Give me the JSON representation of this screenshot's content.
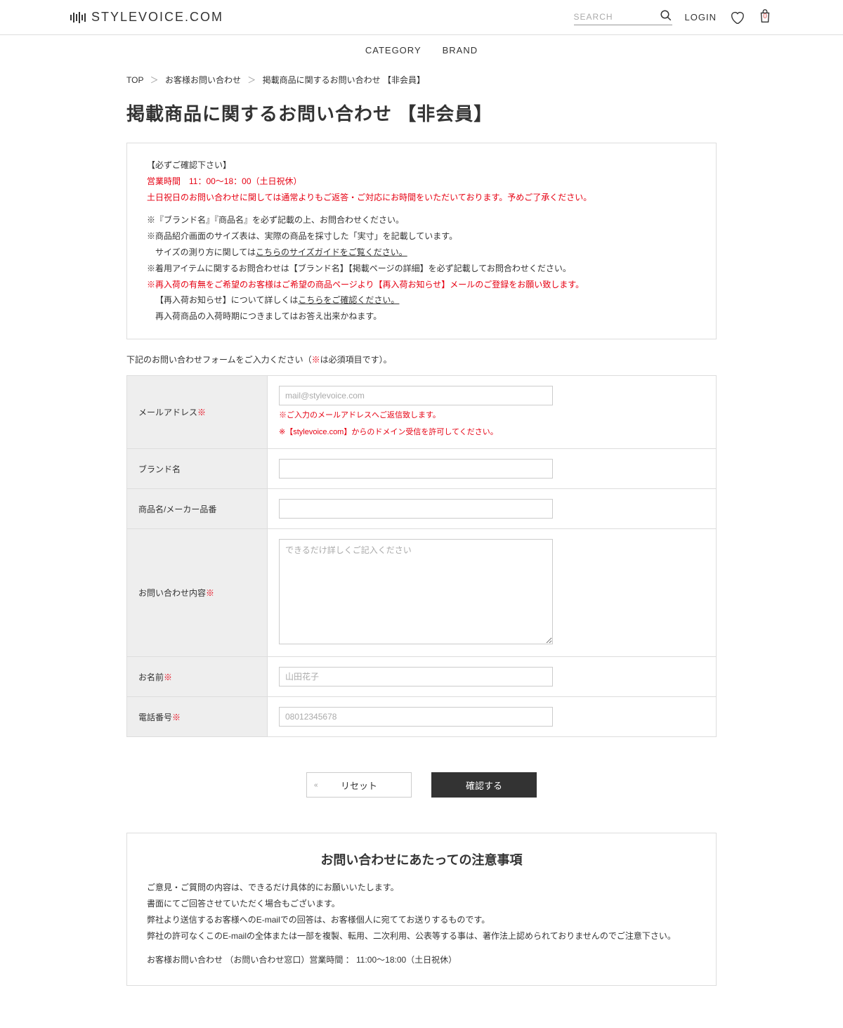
{
  "header": {
    "logo_text": "STYLEVOICE.COM",
    "search_placeholder": "SEARCH",
    "login": "LOGIN",
    "bag_count": "0"
  },
  "nav": {
    "category": "CATEGORY",
    "brand": "BRAND"
  },
  "breadcrumb": {
    "top": "TOP",
    "inquiry": "お客様お問い合わせ",
    "current": "掲載商品に関するお問い合わせ 【非会員】"
  },
  "page_title": "掲載商品に関するお問い合わせ 【非会員】",
  "notice": {
    "confirm_title": "【必ずご確認下さい】",
    "hours": "営業時間　11：00〜18：00（土日祝休）",
    "holiday_note": "土日祝日のお問い合わせに関しては通常よりもご返答・ご対応にお時間をいただいております。予めご了承ください。",
    "l1": "※『ブランド名』『商品名』を必ず記載の上、お問合わせください。",
    "l2": "※商品紹介画面のサイズ表は、実際の商品を採寸した「実寸」を記載しています。",
    "l3a": "サイズの測り方に関しては",
    "l3b": "こちらのサイズガイドをご覧ください。",
    "l4": "※着用アイテムに関するお問合わせは【ブランド名】【掲載ページの詳細】を必ず記載してお問合わせください。",
    "l5": "※再入荷の有無をご希望のお客様はご希望の商品ページより【再入荷お知らせ】メールのご登録をお願い致します。",
    "l6a": "【再入荷お知らせ】について詳しくは",
    "l6b": "こちらをご確認ください。",
    "l7": "再入荷商品の入荷時期につきましてはお答え出来かねます。"
  },
  "form_intro_a": "下記のお問い合わせフォームをご入力ください（",
  "form_intro_req": "※",
  "form_intro_b": "は必須項目です）。",
  "form": {
    "email_label": "メールアドレス",
    "email_placeholder": "mail@stylevoice.com",
    "email_note1": "※ご入力のメールアドレスへご返信致します。",
    "email_note2": "※【stylevoice.com】からのドメイン受信を許可してください。",
    "brand_label": "ブランド名",
    "product_label": "商品名/メーカー品番",
    "content_label": "お問い合わせ内容",
    "content_placeholder": "できるだけ詳しくご記入ください",
    "name_label": "お名前",
    "name_placeholder": "山田花子",
    "phone_label": "電話番号",
    "phone_placeholder": "08012345678"
  },
  "buttons": {
    "reset": "リセット",
    "submit": "確認する"
  },
  "footer": {
    "title": "お問い合わせにあたっての注意事項",
    "p1": "ご意見・ご質問の内容は、できるだけ具体的にお願いいたします。",
    "p2": "書面にてご回答させていただく場合もございます。",
    "p3": "弊社より送信するお客様へのE-mailでの回答は、お客様個人に宛ててお送りするものです。",
    "p4": "弊社の許可なくこのE-mailの全体または一部を複製、転用、二次利用、公表等する事は、著作法上認められておりませんのでご注意下さい。",
    "p5": "お客様お問い合わせ （お問い合わせ窓口）営業時間 ： 11:00〜18:00（土日祝休）"
  }
}
